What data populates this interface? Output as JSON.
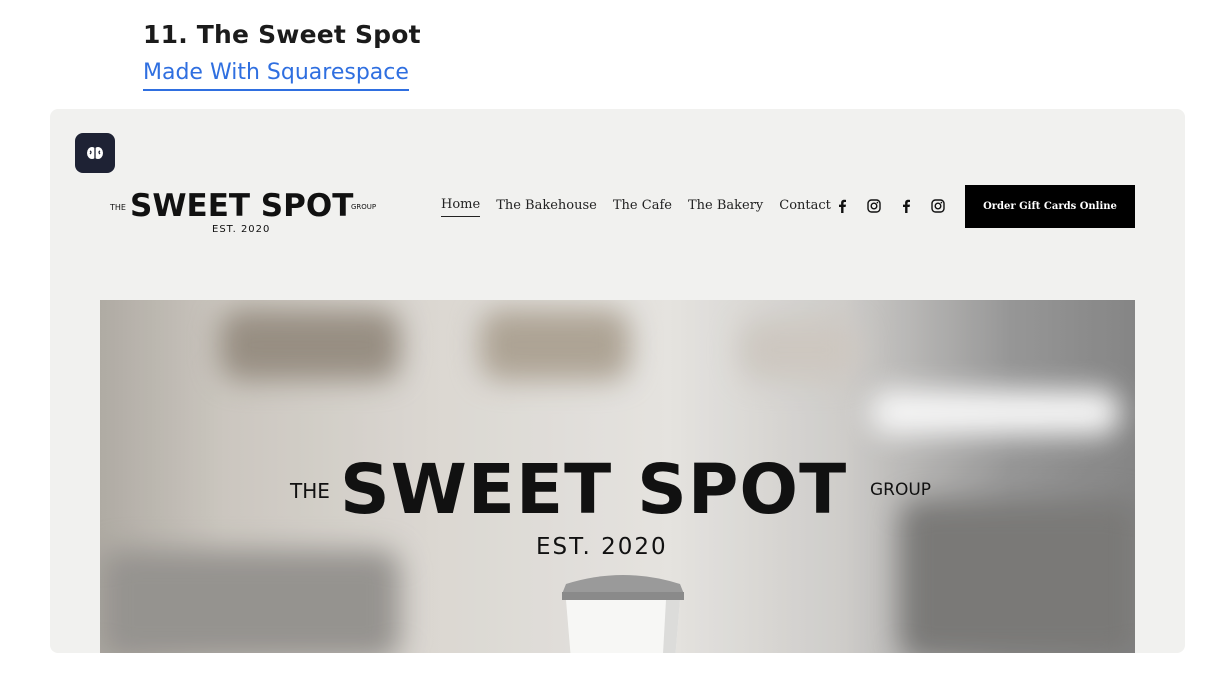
{
  "heading": {
    "title": "11. The Sweet Spot",
    "link_label": "Made With Squarespace"
  },
  "colors": {
    "link": "#2f6fe0",
    "card_bg": "#f1f1ef",
    "badge_bg": "#1e2234",
    "button_bg": "#000000"
  },
  "site": {
    "logo": {
      "the": "THE",
      "main": "SWEET SPOT",
      "group": "GROUP",
      "est": "EST. 2020"
    },
    "nav": [
      {
        "label": "Home",
        "active": true
      },
      {
        "label": "The Bakehouse",
        "active": false
      },
      {
        "label": "The Cafe",
        "active": false
      },
      {
        "label": "The Bakery",
        "active": false
      },
      {
        "label": "Contact",
        "active": false
      }
    ],
    "social_icons": [
      "facebook-icon",
      "instagram-icon",
      "facebook-icon",
      "instagram-icon"
    ],
    "cta_label": "Order Gift Cards Online",
    "hero": {
      "the": "THE",
      "main": "SWEET SPOT",
      "group": "GROUP",
      "est": "EST. 2020"
    }
  }
}
